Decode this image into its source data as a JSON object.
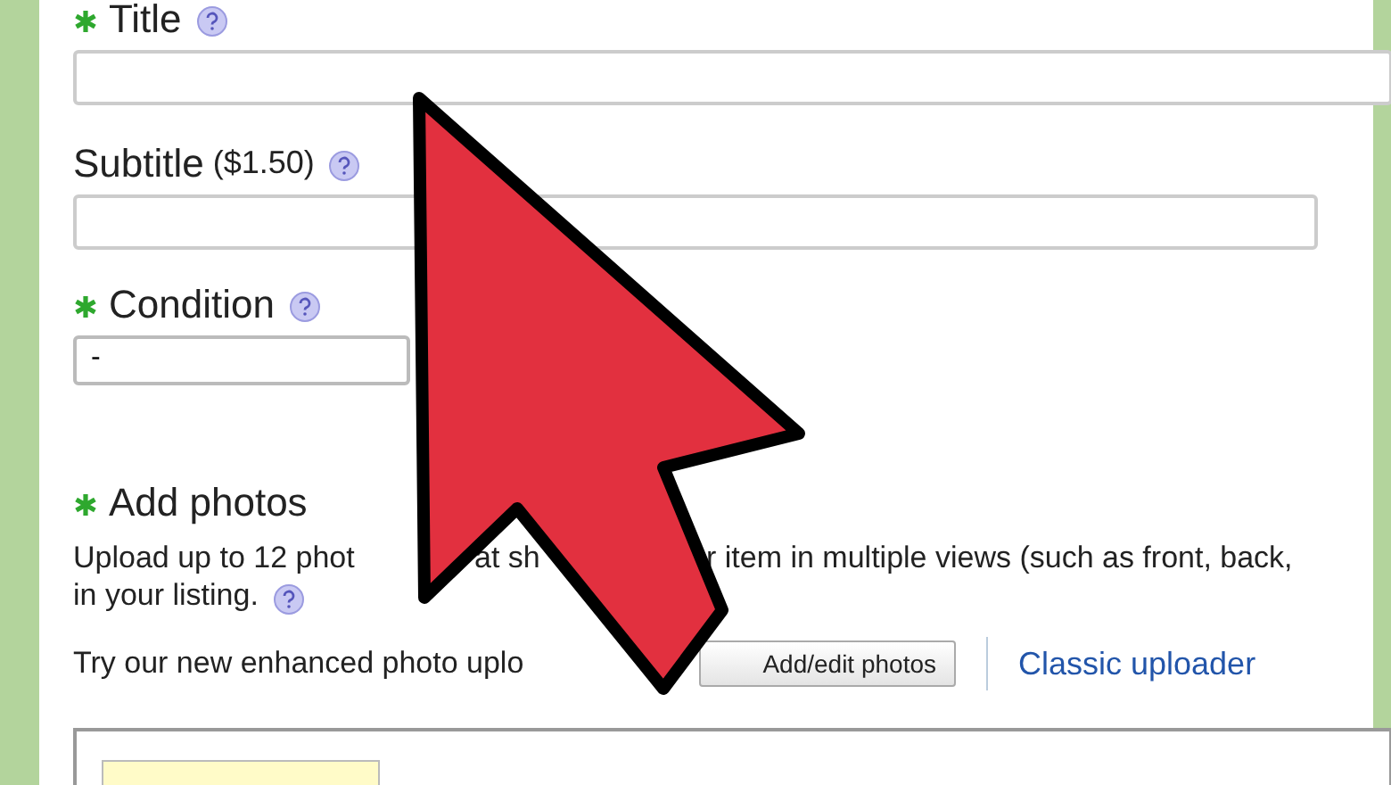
{
  "fields": [
    {
      "label": "Title",
      "required": true,
      "kind": "text"
    },
    {
      "label": "Subtitle",
      "note": "($1.50)",
      "required": false,
      "kind": "text"
    },
    {
      "label": "Condition",
      "required": true,
      "kind": "select",
      "value": "-"
    }
  ],
  "photos": {
    "heading": "Add photos",
    "required": true,
    "description_fragments": [
      "Upload up to 12 phot",
      "at sh",
      "r item in multiple views (such as front, back,"
    ],
    "description_line_2": "in your listing.",
    "uploader_text": "Try our new enhanced photo uplo",
    "button": "Add/edit photos",
    "link": "Classic uploader"
  }
}
